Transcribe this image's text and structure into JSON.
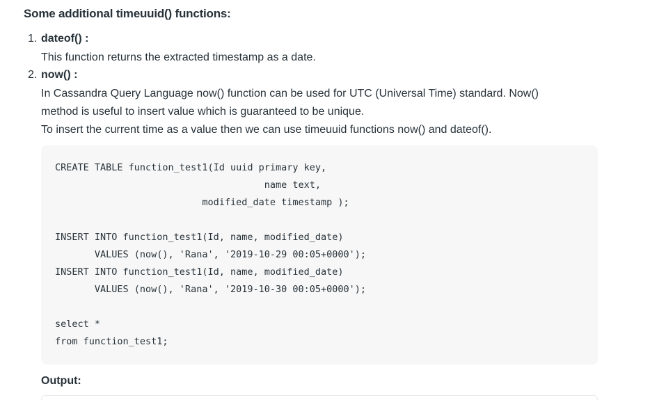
{
  "heading": "Some additional timeuuid() functions:",
  "items": [
    {
      "number": "1.",
      "title": "dateof() :",
      "lines": [
        "This function returns the extracted timestamp as a date."
      ]
    },
    {
      "number": "2.",
      "title": "now() :",
      "lines": [
        "In Cassandra Query Language now() function can be used for UTC (Universal Time) standard. Now()",
        "method is useful to insert value which is guaranteed to be unique.",
        "To insert the current time as a value then we can use timeuuid functions now() and dateof()."
      ]
    }
  ],
  "code": "CREATE TABLE function_test1(Id uuid primary key,\n                                     name text,\n                          modified_date timestamp );\n\nINSERT INTO function_test1(Id, name, modified_date)\n       VALUES (now(), 'Rana', '2019-10-29 00:05+0000');\nINSERT INTO function_test1(Id, name, modified_date)\n       VALUES (now(), 'Rana', '2019-10-30 00:05+0000');\n\nselect *\nfrom function_test1;",
  "output_label": "Output:"
}
